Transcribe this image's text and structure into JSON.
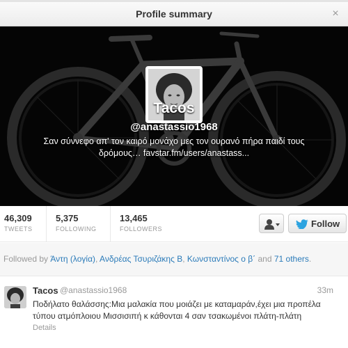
{
  "modal": {
    "title": "Profile summary",
    "close_icon": "×"
  },
  "profile": {
    "name": "Tacos",
    "handle": "@anastassio1968",
    "bio_line1": "Σαν σύννεφο απ' τον καιρό μονάχο μες τον ουρανό πήρα παιδί τους",
    "bio_line2": "δρόμους… favstar.fm/users/anastass..."
  },
  "stats": [
    {
      "value": "46,309",
      "label": "TWEETS"
    },
    {
      "value": "5,375",
      "label": "FOLLOWING"
    },
    {
      "value": "13,465",
      "label": "FOLLOWERS"
    }
  ],
  "actions": {
    "user_menu_icon": "user-dropdown-icon",
    "follow_label": "Follow",
    "follow_icon": "twitter-bird-icon"
  },
  "followed_by": {
    "prefix": "Followed by",
    "names": [
      "Άντη (λογία)",
      "Ανδρέας Τσυριζάκης Β",
      "Κωνσταντίνος ο β΄"
    ],
    "sep1": ", ",
    "sep2": ", ",
    "and": " and ",
    "others": "71 others",
    "suffix": "."
  },
  "tweet": {
    "author": "Tacos",
    "handle": "@anastassio1968",
    "time": "33m",
    "text": "Ποδήλατο θαλάσσης:Μια μαλακία που μοιάζει με καταμαράν,έχει μια προπέλα τύπου ατμόπλοιου Μισσισιπή κ κάθονται 4 σαν τσακωμένοι πλάτη-πλάτη",
    "details_label": "Details"
  },
  "colors": {
    "link": "#2b7bb9",
    "twitter_blue": "#2ca3e0",
    "banner_bg": "#050505"
  }
}
